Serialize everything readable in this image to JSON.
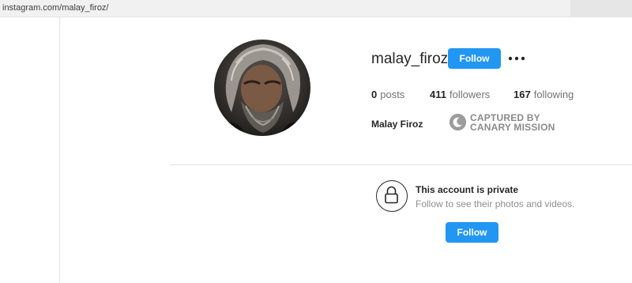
{
  "browser": {
    "url": "instagram.com/malay_firoz/"
  },
  "profile": {
    "username": "malay_firoz",
    "follow_label": "Follow",
    "more_icon": "more-horizontal-icon",
    "stats": {
      "posts_count": "0",
      "posts_label": "posts",
      "followers_count": "411",
      "followers_label": "followers",
      "following_count": "167",
      "following_label": "following"
    },
    "full_name": "Malay Firoz"
  },
  "watermark": {
    "line1": "CAPTURED BY",
    "line2": "CANARY MISSION"
  },
  "private_notice": {
    "title": "This account is private",
    "subtitle": "Follow to see their photos and videos.",
    "follow_label": "Follow",
    "icon": "lock-icon"
  },
  "colors": {
    "follow_button": "#2196f3",
    "divider": "#e0e0e0",
    "muted_text": "#737373"
  }
}
